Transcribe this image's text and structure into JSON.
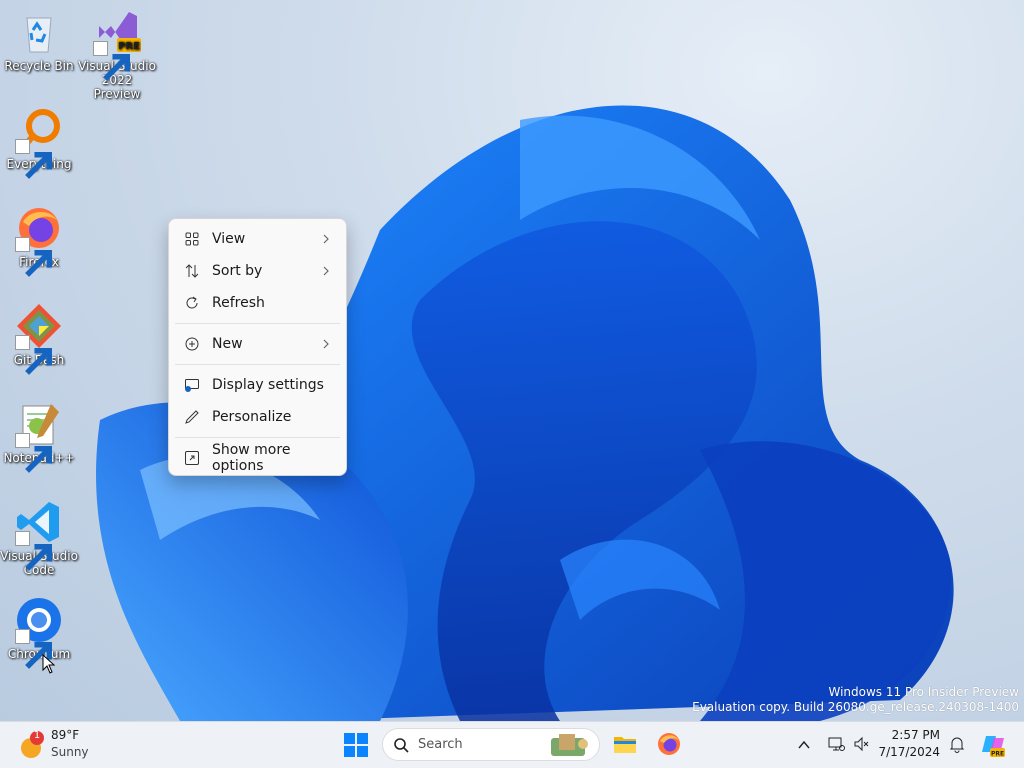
{
  "desktop": {
    "icons": [
      {
        "label": "Recycle Bin",
        "icon": "recycle-bin-icon"
      },
      {
        "label": "Visual Studio 2022 Preview",
        "icon": "visual-studio-preview-icon",
        "badge": "PRE"
      },
      {
        "label": "Everything",
        "icon": "everything-search-icon"
      },
      {
        "label": "Firefox",
        "icon": "firefox-icon"
      },
      {
        "label": "Git Bash",
        "icon": "git-bash-icon"
      },
      {
        "label": "Notepad++",
        "icon": "notepadpp-icon"
      },
      {
        "label": "Visual Studio Code",
        "icon": "vscode-icon"
      },
      {
        "label": "Chromium",
        "icon": "chromium-icon"
      }
    ],
    "watermark": {
      "line1": "Windows 11 Pro Insider Preview",
      "line2": "Evaluation copy. Build 26080.ge_release.240308-1400"
    }
  },
  "context_menu": {
    "items": [
      {
        "label": "View",
        "icon": "grid-icon",
        "submenu": true
      },
      {
        "label": "Sort by",
        "icon": "sort-icon",
        "submenu": true
      },
      {
        "label": "Refresh",
        "icon": "refresh-icon",
        "submenu": false
      },
      {
        "label": "New",
        "icon": "plus-circle-icon",
        "submenu": true
      },
      {
        "label": "Display settings",
        "icon": "display-icon",
        "submenu": false
      },
      {
        "label": "Personalize",
        "icon": "pen-icon",
        "submenu": false
      },
      {
        "label": "Show more options",
        "icon": "more-options-icon",
        "submenu": false
      }
    ]
  },
  "taskbar": {
    "weather": {
      "temp": "89°F",
      "condition": "Sunny",
      "badge": "1"
    },
    "search_placeholder": "Search",
    "pinned": [
      "windows-start-icon",
      "file-explorer-icon",
      "firefox-icon"
    ],
    "clock": {
      "time": "2:57 PM",
      "date": "7/17/2024"
    },
    "accent": "#0078d4"
  }
}
